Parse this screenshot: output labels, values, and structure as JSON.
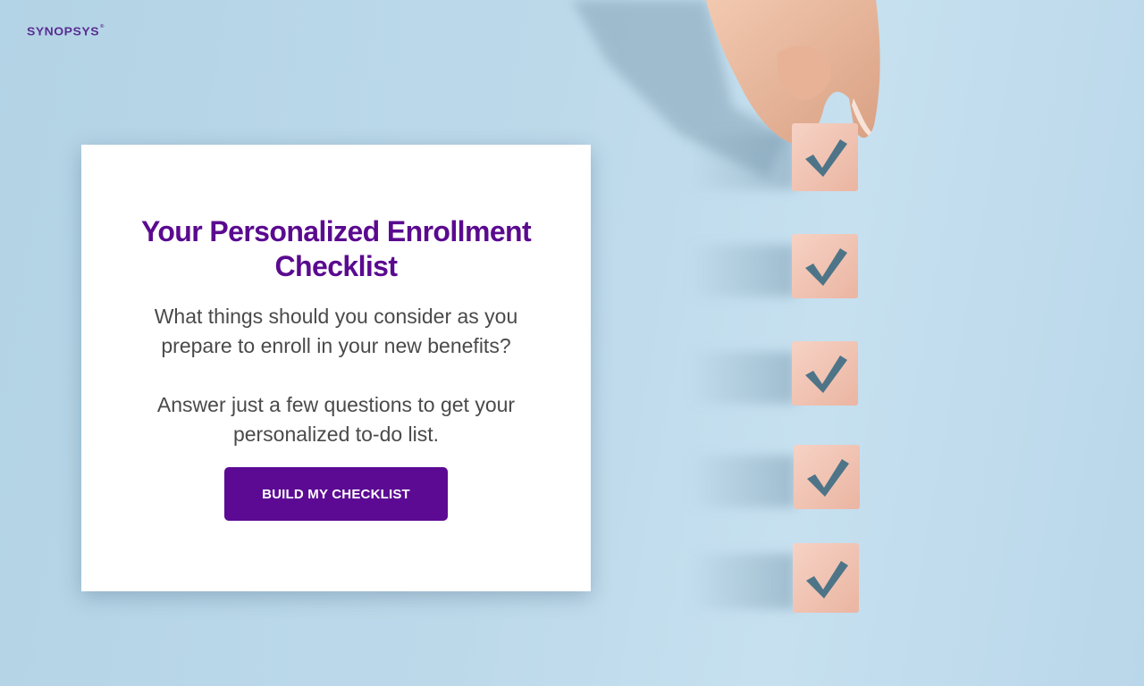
{
  "brand": {
    "logo_text": "SYNOPSYS",
    "logo_mark": "®",
    "color": "#5a2d91"
  },
  "card": {
    "title": "Your Personalized Enrollment Checklist",
    "intro": "What things should you consider as you prepare to enroll in your new benefits?",
    "instruction": "Answer just a few questions to get your personalized to-do list.",
    "button_label": "BUILD MY CHECKLIST"
  },
  "colors": {
    "title": "#5a0a8f",
    "button": "#5c0a93",
    "body_text": "#4a4a4a",
    "background": "#b9d7ea",
    "block": "#f1c4b3",
    "checkmark": "#4e7488"
  },
  "image": {
    "subject": "hand-placing-checkmark-blocks",
    "block_icon": "checkmark-icon",
    "block_count": 5
  }
}
